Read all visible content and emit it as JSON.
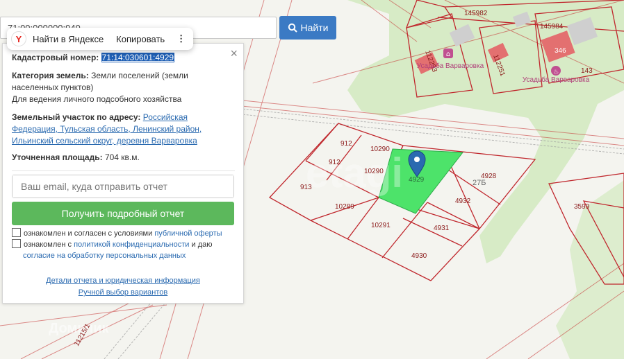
{
  "search": {
    "value": "71:00:000000:949",
    "button_label": "Найти"
  },
  "context_menu": {
    "logo": "Y",
    "open_label": "Найти в Яндексе",
    "copy_label": "Копировать",
    "more_icon": "⋮"
  },
  "panel": {
    "close_icon": "×",
    "cadastral_label": "Кадастровый номер:",
    "cadastral_value": "71:14:030601:4929",
    "category_label": "Категория земель:",
    "category_value": "Земли поселений (земли населенных пунктов)",
    "usage": "Для ведения личного подсобного хозяйства",
    "address_label": "Земельный участок по адресу:",
    "address_value": "Российская Федерация, Тульская область, Ленинский район, Ильинский сельский округ, деревня Варваровка",
    "area_label": "Уточненная площадь:",
    "area_value": "704 кв.м.",
    "email_placeholder": "Ваш email, куда отправить отчет",
    "report_button": "Получить подробный отчет",
    "consent1_prefix": "ознакомлен и согласен с условиями",
    "consent1_link": "публичной оферты",
    "consent2_prefix": "ознакомлен с",
    "consent2_link": "политикой конфиденциальности",
    "consent2_mid": "и даю",
    "consent2_link2": "согласие на обработку персональных данных",
    "details_link": "Детали отчета и юридическая информация",
    "manual_link": "Ручной выбор вариантов"
  },
  "map": {
    "plots": [
      "912",
      "10290",
      "912",
      "10290",
      "913",
      "10289",
      "4929",
      "4928",
      "27Б",
      "4932",
      "10291",
      "4931",
      "4930",
      "3599",
      "145982",
      "145984",
      "346",
      "143",
      "112253",
      "112251",
      "11215/1"
    ],
    "pois": [
      "Усадьба Варваровка",
      "Усадьба Варваровка"
    ],
    "watermark": "etagi",
    "watermark2": "Домклик"
  },
  "colors": {
    "selected_plot": "#4de36a",
    "plot_border": "#c0272d",
    "greenery": "#d8ecc8",
    "building": "#e37070",
    "search_button": "#3b7ac4",
    "report_button": "#5cb85c",
    "marker": "#2a6ab0"
  }
}
